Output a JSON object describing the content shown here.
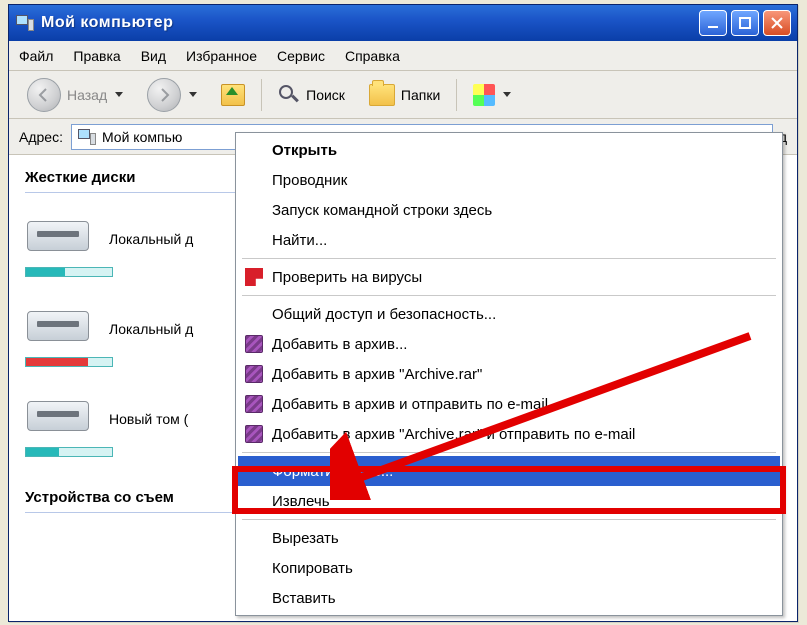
{
  "window": {
    "title": "Мой компьютер"
  },
  "menubar": {
    "file": "Файл",
    "edit": "Правка",
    "view": "Вид",
    "favorites": "Избранное",
    "tools": "Сервис",
    "help": "Справка"
  },
  "toolbar": {
    "back": "Назад",
    "search": "Поиск",
    "folders": "Папки"
  },
  "addressbar": {
    "label": "Адрес:",
    "value": "Мой компью",
    "truncated_right": "д"
  },
  "groups": {
    "hdd": "Жесткие диски",
    "removable": "Устройства со съем"
  },
  "drives": [
    {
      "label": "Локальный д",
      "fill_pct": 45,
      "fill_color": "#27b9b9"
    },
    {
      "label": "Локальный д",
      "fill_pct": 72,
      "fill_color": "#e43a3a"
    },
    {
      "label": "Новый том (",
      "fill_pct": 38,
      "fill_color": "#27b9b9"
    }
  ],
  "context_menu": {
    "open": "Открыть",
    "explorer": "Проводник",
    "cmd_here": "Запуск командной строки здесь",
    "find": "Найти...",
    "antivirus": "Проверить на вирусы",
    "sharing": "Общий доступ и безопасность...",
    "rar_add": "Добавить в архив...",
    "rar_add_named": "Добавить в архив \"Archive.rar\"",
    "rar_add_email": "Добавить в архив и отправить по e-mail...",
    "rar_add_named_email": "Добавить в архив \"Archive.rar\" и отправить по e-mail",
    "format": "Форматировать...",
    "eject": "Извлечь",
    "cut": "Вырезать",
    "copy": "Копировать",
    "paste": "Вставить"
  }
}
